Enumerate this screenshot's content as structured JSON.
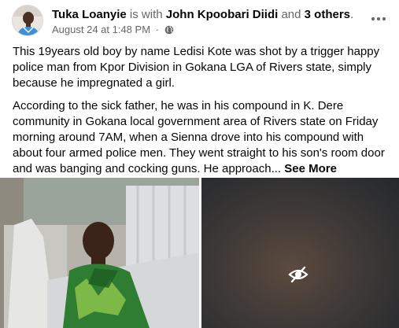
{
  "post": {
    "author_name": "Tuka Loanyie",
    "is_with_text": "is with",
    "tagged_name": "John Kpoobari Diidi",
    "and_text": "and",
    "others_text": "3 others",
    "end_punct": ".",
    "timestamp": "August 24 at 1:48 PM",
    "separator": "·",
    "paragraph_1": "This 19years old boy by name Ledisi Kote was shot by a trigger happy police man from Kpor Division in Gokana LGA of Rivers state, simply because he impregnated a girl.",
    "paragraph_2": "According to the sick father, he was in his compound in K. Dere community in Gokana local government area of Rivers state on Friday morning around 7AM, when a Sienna drove into his compound with about four armed police men. They went straight to his son's room door and was banging and cocking guns. He approach...",
    "see_more_label": "See More"
  },
  "icons": {
    "privacy": "globe-icon",
    "options": "more-horizontal-icon",
    "hidden_photo": "eye-slash-icon"
  },
  "colors": {
    "text_primary": "#050505",
    "text_secondary": "#65676b",
    "background": "#ffffff"
  }
}
